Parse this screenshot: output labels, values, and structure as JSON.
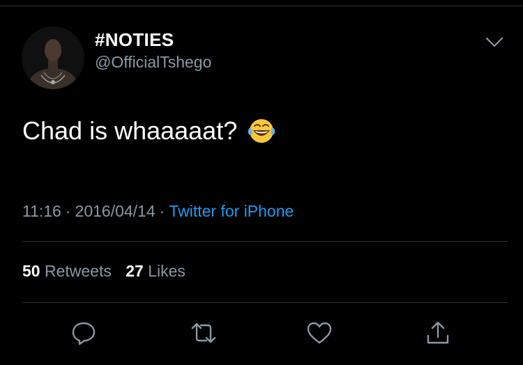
{
  "tweet": {
    "display_name": "#NOTIES",
    "handle": "@OfficialTshego",
    "text": "Chad is whaaaaat?",
    "emoji": "face-with-tears-of-joy",
    "time": "11:16",
    "date": "2016/04/14",
    "separator": "·",
    "source": "Twitter for iPhone"
  },
  "stats": {
    "retweets_count": "50",
    "retweets_label": "Retweets",
    "likes_count": "27",
    "likes_label": "Likes"
  },
  "actions": [
    "reply-icon",
    "retweet-icon",
    "like-icon",
    "share-icon"
  ],
  "colors": {
    "background": "#000000",
    "text_primary": "#ffffff",
    "text_secondary": "#8b98a5",
    "link": "#1d9bf0",
    "divider": "#2f3336"
  }
}
